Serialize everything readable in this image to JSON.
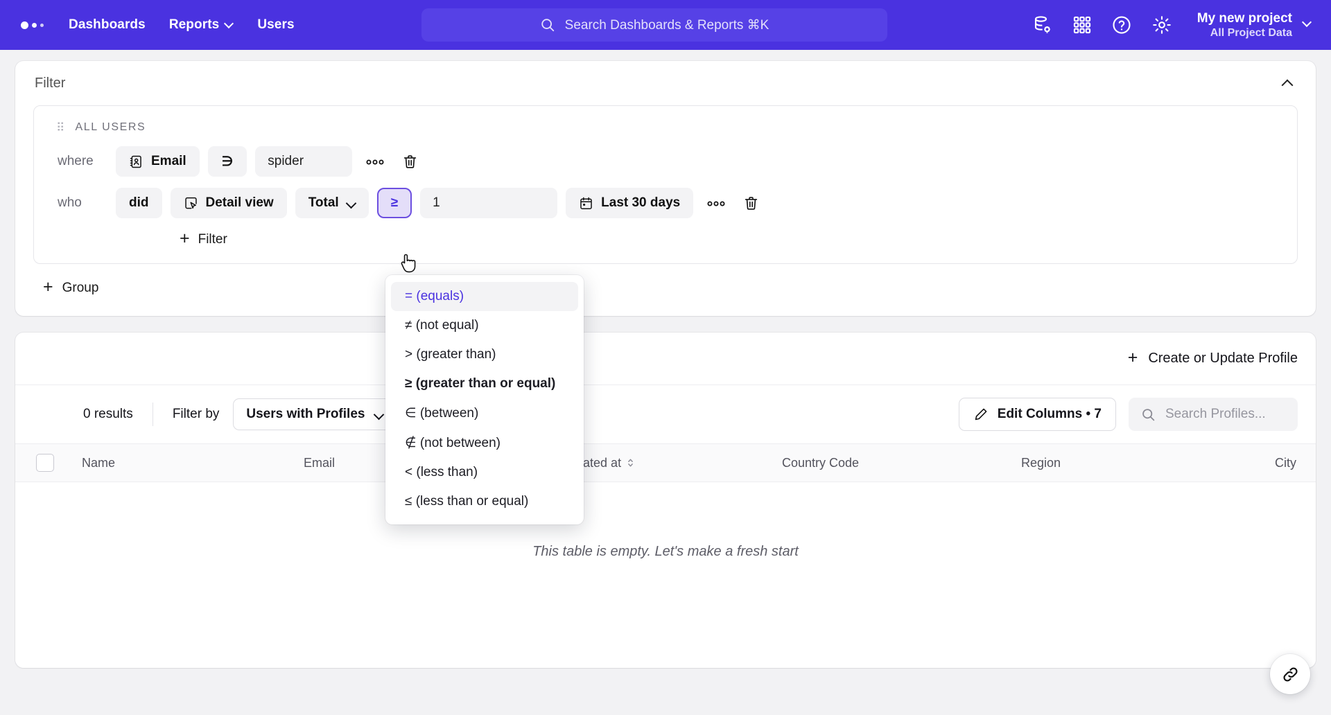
{
  "topnav": {
    "logo": "app-logo-dots",
    "links": [
      {
        "label": "Dashboards",
        "has_caret": false
      },
      {
        "label": "Reports",
        "has_caret": true
      },
      {
        "label": "Users",
        "has_caret": false
      }
    ],
    "search": {
      "placeholder": "Search Dashboards & Reports ⌘K",
      "value": ""
    },
    "icons": [
      "database-settings-icon",
      "grid-apps-icon",
      "help-circle-icon",
      "gear-icon"
    ],
    "project": {
      "name": "My new project",
      "subtitle": "All Project Data"
    },
    "accent": "#4a32e0"
  },
  "filter_panel": {
    "title": "Filter",
    "collapse_icon": "chevron-up-icon",
    "group": {
      "label": "ALL USERS",
      "conditions": [
        {
          "keyword": "where",
          "property_icon": "contact-card-icon",
          "property": "Email",
          "operator": "∋",
          "value": "spider",
          "more": "⚬⚬⚬",
          "delete_icon": "trash-icon"
        },
        {
          "keyword": "who",
          "verb": "did",
          "event_icon": "click-target-icon",
          "event": "Detail view",
          "aggregate": "Total",
          "operator": "≥",
          "value": "1",
          "date_icon": "calendar-icon",
          "date_range": "Last 30 days",
          "more": "⚬⚬⚬",
          "delete_icon": "trash-icon"
        }
      ],
      "add_filter_label": "Filter"
    },
    "add_group_label": "Group"
  },
  "operator_dropdown": {
    "items": [
      {
        "label": "= (equals)",
        "selected": true,
        "bold": false
      },
      {
        "label": "≠ (not equal)",
        "selected": false,
        "bold": false
      },
      {
        "label": "> (greater than)",
        "selected": false,
        "bold": false
      },
      {
        "label": "≥ (greater than or equal)",
        "selected": false,
        "bold": true
      },
      {
        "label": "∈ (between)",
        "selected": false,
        "bold": false
      },
      {
        "label": "∉ (not between)",
        "selected": false,
        "bold": false
      },
      {
        "label": "< (less than)",
        "selected": false,
        "bold": false
      },
      {
        "label": "≤ (less than or equal)",
        "selected": false,
        "bold": false
      }
    ]
  },
  "results_panel": {
    "create_button": {
      "label": "Create or Update Profile",
      "icon": "plus-icon"
    },
    "result_count": "0 results",
    "filter_by_label": "Filter by",
    "filter_by_value": "Users with Profiles",
    "edit_columns": "Edit Columns • 7",
    "edit_columns_icon": "pencil-icon",
    "search": {
      "placeholder": "Search Profiles...",
      "value": "",
      "icon": "search-icon"
    },
    "table": {
      "columns": [
        "Name",
        "Email",
        "Updated at",
        "Country Code",
        "Region",
        "City"
      ],
      "sortable_column": "Updated at",
      "rows": [],
      "empty_message": "This table is empty. Let's make a fresh start"
    }
  },
  "fab": {
    "icon": "link-chain-icon"
  }
}
